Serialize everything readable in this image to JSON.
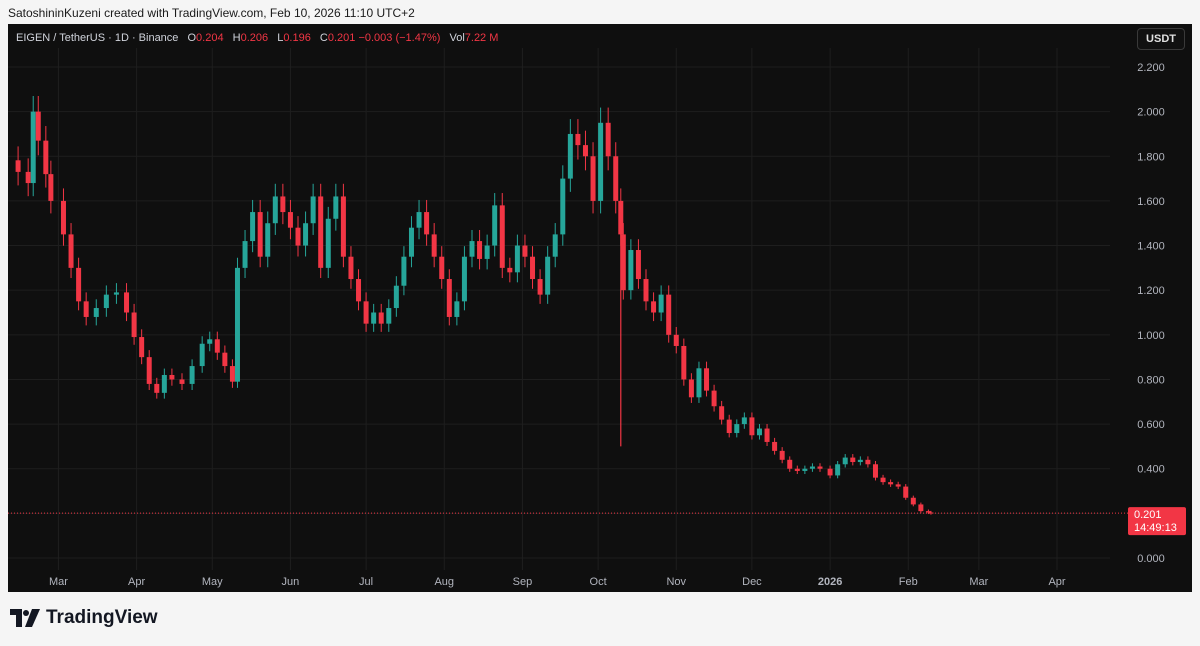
{
  "header": {
    "credit": "SatoshininKuzeni created with TradingView.com, Feb 10, 2026 11:10 UTC+2"
  },
  "legend": {
    "symbol": "EIGEN / TetherUS · 1D · Binance",
    "o_label": "O",
    "o_value": "0.204",
    "h_label": "H",
    "h_value": "0.206",
    "l_label": "L",
    "l_value": "0.196",
    "c_label": "C",
    "c_value": "0.201",
    "change": "−0.003 (−1.47%)",
    "vol_label": "Vol",
    "vol_value": "7.22 M"
  },
  "currency_button": "USDT",
  "price_tag": {
    "price": "0.201",
    "countdown": "14:49:13"
  },
  "branding": {
    "wordmark": "TradingView"
  },
  "colors": {
    "up": "#26a69a",
    "down": "#f23645",
    "background": "#0f0f0f",
    "grid": "#1e1e1e"
  },
  "chart_data": {
    "type": "candlestick",
    "title": "EIGEN / TetherUS · 1D · Binance",
    "ylim": [
      0,
      2.2
    ],
    "y_ticks": [
      "0.000",
      "0.200",
      "0.400",
      "0.600",
      "0.800",
      "1.000",
      "1.200",
      "1.400",
      "1.600",
      "1.800",
      "2.000",
      "2.200"
    ],
    "x_ticks": [
      "Mar",
      "Apr",
      "May",
      "Jun",
      "Jul",
      "Aug",
      "Sep",
      "Oct",
      "Nov",
      "Dec",
      "2026",
      "Feb",
      "Mar",
      "Apr"
    ],
    "last_price": 0.201,
    "series": [
      {
        "date": "2025-02-13",
        "close": 1.73
      },
      {
        "date": "2025-02-17",
        "close": 1.68
      },
      {
        "date": "2025-02-19",
        "close": 2.0
      },
      {
        "date": "2025-02-21",
        "close": 1.87
      },
      {
        "date": "2025-02-24",
        "close": 1.72
      },
      {
        "date": "2025-02-26",
        "close": 1.6
      },
      {
        "date": "2025-03-03",
        "close": 1.45
      },
      {
        "date": "2025-03-06",
        "close": 1.3
      },
      {
        "date": "2025-03-09",
        "close": 1.15
      },
      {
        "date": "2025-03-12",
        "close": 1.08
      },
      {
        "date": "2025-03-16",
        "close": 1.12
      },
      {
        "date": "2025-03-20",
        "close": 1.18
      },
      {
        "date": "2025-03-24",
        "close": 1.19
      },
      {
        "date": "2025-03-28",
        "close": 1.1
      },
      {
        "date": "2025-03-31",
        "close": 0.99
      },
      {
        "date": "2025-04-03",
        "close": 0.9
      },
      {
        "date": "2025-04-06",
        "close": 0.78
      },
      {
        "date": "2025-04-09",
        "close": 0.74
      },
      {
        "date": "2025-04-12",
        "close": 0.82
      },
      {
        "date": "2025-04-15",
        "close": 0.8
      },
      {
        "date": "2025-04-19",
        "close": 0.78
      },
      {
        "date": "2025-04-23",
        "close": 0.86
      },
      {
        "date": "2025-04-27",
        "close": 0.96
      },
      {
        "date": "2025-04-30",
        "close": 0.98
      },
      {
        "date": "2025-05-03",
        "close": 0.92
      },
      {
        "date": "2025-05-06",
        "close": 0.86
      },
      {
        "date": "2025-05-09",
        "close": 0.79
      },
      {
        "date": "2025-05-11",
        "close": 1.3
      },
      {
        "date": "2025-05-14",
        "close": 1.42
      },
      {
        "date": "2025-05-17",
        "close": 1.55
      },
      {
        "date": "2025-05-20",
        "close": 1.35
      },
      {
        "date": "2025-05-23",
        "close": 1.5
      },
      {
        "date": "2025-05-26",
        "close": 1.62
      },
      {
        "date": "2025-05-29",
        "close": 1.55
      },
      {
        "date": "2025-06-01",
        "close": 1.48
      },
      {
        "date": "2025-06-04",
        "close": 1.4
      },
      {
        "date": "2025-06-07",
        "close": 1.5
      },
      {
        "date": "2025-06-10",
        "close": 1.62
      },
      {
        "date": "2025-06-13",
        "close": 1.3
      },
      {
        "date": "2025-06-16",
        "close": 1.52
      },
      {
        "date": "2025-06-19",
        "close": 1.62
      },
      {
        "date": "2025-06-22",
        "close": 1.35
      },
      {
        "date": "2025-06-25",
        "close": 1.25
      },
      {
        "date": "2025-06-28",
        "close": 1.15
      },
      {
        "date": "2025-07-01",
        "close": 1.05
      },
      {
        "date": "2025-07-04",
        "close": 1.1
      },
      {
        "date": "2025-07-07",
        "close": 1.05
      },
      {
        "date": "2025-07-10",
        "close": 1.12
      },
      {
        "date": "2025-07-13",
        "close": 1.22
      },
      {
        "date": "2025-07-16",
        "close": 1.35
      },
      {
        "date": "2025-07-19",
        "close": 1.48
      },
      {
        "date": "2025-07-22",
        "close": 1.55
      },
      {
        "date": "2025-07-25",
        "close": 1.45
      },
      {
        "date": "2025-07-28",
        "close": 1.35
      },
      {
        "date": "2025-07-31",
        "close": 1.25
      },
      {
        "date": "2025-08-03",
        "close": 1.08
      },
      {
        "date": "2025-08-06",
        "close": 1.15
      },
      {
        "date": "2025-08-09",
        "close": 1.35
      },
      {
        "date": "2025-08-12",
        "close": 1.42
      },
      {
        "date": "2025-08-15",
        "close": 1.34
      },
      {
        "date": "2025-08-18",
        "close": 1.4
      },
      {
        "date": "2025-08-21",
        "close": 1.58
      },
      {
        "date": "2025-08-24",
        "close": 1.3
      },
      {
        "date": "2025-08-27",
        "close": 1.28
      },
      {
        "date": "2025-08-30",
        "close": 1.4
      },
      {
        "date": "2025-09-02",
        "close": 1.35
      },
      {
        "date": "2025-09-05",
        "close": 1.25
      },
      {
        "date": "2025-09-08",
        "close": 1.18
      },
      {
        "date": "2025-09-11",
        "close": 1.35
      },
      {
        "date": "2025-09-14",
        "close": 1.45
      },
      {
        "date": "2025-09-17",
        "close": 1.7
      },
      {
        "date": "2025-09-20",
        "close": 1.9
      },
      {
        "date": "2025-09-23",
        "close": 1.85
      },
      {
        "date": "2025-09-26",
        "close": 1.8
      },
      {
        "date": "2025-09-29",
        "close": 1.6
      },
      {
        "date": "2025-10-02",
        "close": 1.95
      },
      {
        "date": "2025-10-05",
        "close": 1.8
      },
      {
        "date": "2025-10-08",
        "close": 1.6
      },
      {
        "date": "2025-10-10",
        "close": 1.45
      },
      {
        "date": "2025-10-11",
        "close": 1.2
      },
      {
        "date": "2025-10-14",
        "close": 1.38
      },
      {
        "date": "2025-10-17",
        "close": 1.25
      },
      {
        "date": "2025-10-20",
        "close": 1.15
      },
      {
        "date": "2025-10-23",
        "close": 1.1
      },
      {
        "date": "2025-10-26",
        "close": 1.18
      },
      {
        "date": "2025-10-29",
        "close": 1.0
      },
      {
        "date": "2025-11-01",
        "close": 0.95
      },
      {
        "date": "2025-11-04",
        "close": 0.8
      },
      {
        "date": "2025-11-07",
        "close": 0.72
      },
      {
        "date": "2025-11-10",
        "close": 0.85
      },
      {
        "date": "2025-11-13",
        "close": 0.75
      },
      {
        "date": "2025-11-16",
        "close": 0.68
      },
      {
        "date": "2025-11-19",
        "close": 0.62
      },
      {
        "date": "2025-11-22",
        "close": 0.56
      },
      {
        "date": "2025-11-25",
        "close": 0.6
      },
      {
        "date": "2025-11-28",
        "close": 0.63
      },
      {
        "date": "2025-12-01",
        "close": 0.55
      },
      {
        "date": "2025-12-04",
        "close": 0.58
      },
      {
        "date": "2025-12-07",
        "close": 0.52
      },
      {
        "date": "2025-12-10",
        "close": 0.48
      },
      {
        "date": "2025-12-13",
        "close": 0.44
      },
      {
        "date": "2025-12-16",
        "close": 0.4
      },
      {
        "date": "2025-12-19",
        "close": 0.39
      },
      {
        "date": "2025-12-22",
        "close": 0.4
      },
      {
        "date": "2025-12-25",
        "close": 0.41
      },
      {
        "date": "2025-12-28",
        "close": 0.4
      },
      {
        "date": "2026-01-01",
        "close": 0.37
      },
      {
        "date": "2026-01-04",
        "close": 0.42
      },
      {
        "date": "2026-01-07",
        "close": 0.45
      },
      {
        "date": "2026-01-10",
        "close": 0.43
      },
      {
        "date": "2026-01-13",
        "close": 0.44
      },
      {
        "date": "2026-01-16",
        "close": 0.42
      },
      {
        "date": "2026-01-19",
        "close": 0.36
      },
      {
        "date": "2026-01-22",
        "close": 0.34
      },
      {
        "date": "2026-01-25",
        "close": 0.33
      },
      {
        "date": "2026-01-28",
        "close": 0.32
      },
      {
        "date": "2026-01-31",
        "close": 0.27
      },
      {
        "date": "2026-02-03",
        "close": 0.24
      },
      {
        "date": "2026-02-06",
        "close": 0.21
      },
      {
        "date": "2026-02-09",
        "close": 0.204
      },
      {
        "date": "2026-02-10",
        "close": 0.201
      }
    ]
  }
}
